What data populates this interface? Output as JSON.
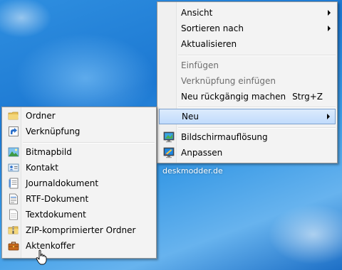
{
  "context_menu": {
    "items": [
      {
        "label": "Ansicht"
      },
      {
        "label": "Sortieren nach"
      },
      {
        "label": "Aktualisieren"
      },
      {
        "label": "Einfügen"
      },
      {
        "label": "Verknüpfung einfügen"
      },
      {
        "label": "Neu rückgängig machen",
        "accelerator": "Strg+Z"
      },
      {
        "label": "Neu"
      },
      {
        "label": "Bildschirmauflösung",
        "icon": "display-settings-icon"
      },
      {
        "label": "Anpassen",
        "icon": "personalize-icon"
      }
    ]
  },
  "new_submenu": {
    "items": [
      {
        "label": "Ordner",
        "icon": "folder-icon"
      },
      {
        "label": "Verknüpfung",
        "icon": "shortcut-icon"
      },
      {
        "label": "Bitmapbild",
        "icon": "bitmap-image-icon"
      },
      {
        "label": "Kontakt",
        "icon": "contact-icon"
      },
      {
        "label": "Journaldokument",
        "icon": "journal-document-icon"
      },
      {
        "label": "RTF-Dokument",
        "icon": "rtf-document-icon"
      },
      {
        "label": "Textdokument",
        "icon": "text-document-icon"
      },
      {
        "label": "ZIP-komprimierter Ordner",
        "icon": "zip-folder-icon"
      },
      {
        "label": "Aktenkoffer",
        "icon": "briefcase-icon"
      }
    ]
  },
  "watermark": "deskmodder.de",
  "colors": {
    "highlight": "#c1dbfc",
    "highlight_border": "#7da2ce",
    "menu_bg": "#f3f3f3",
    "disabled_text": "#6d6d6d"
  }
}
